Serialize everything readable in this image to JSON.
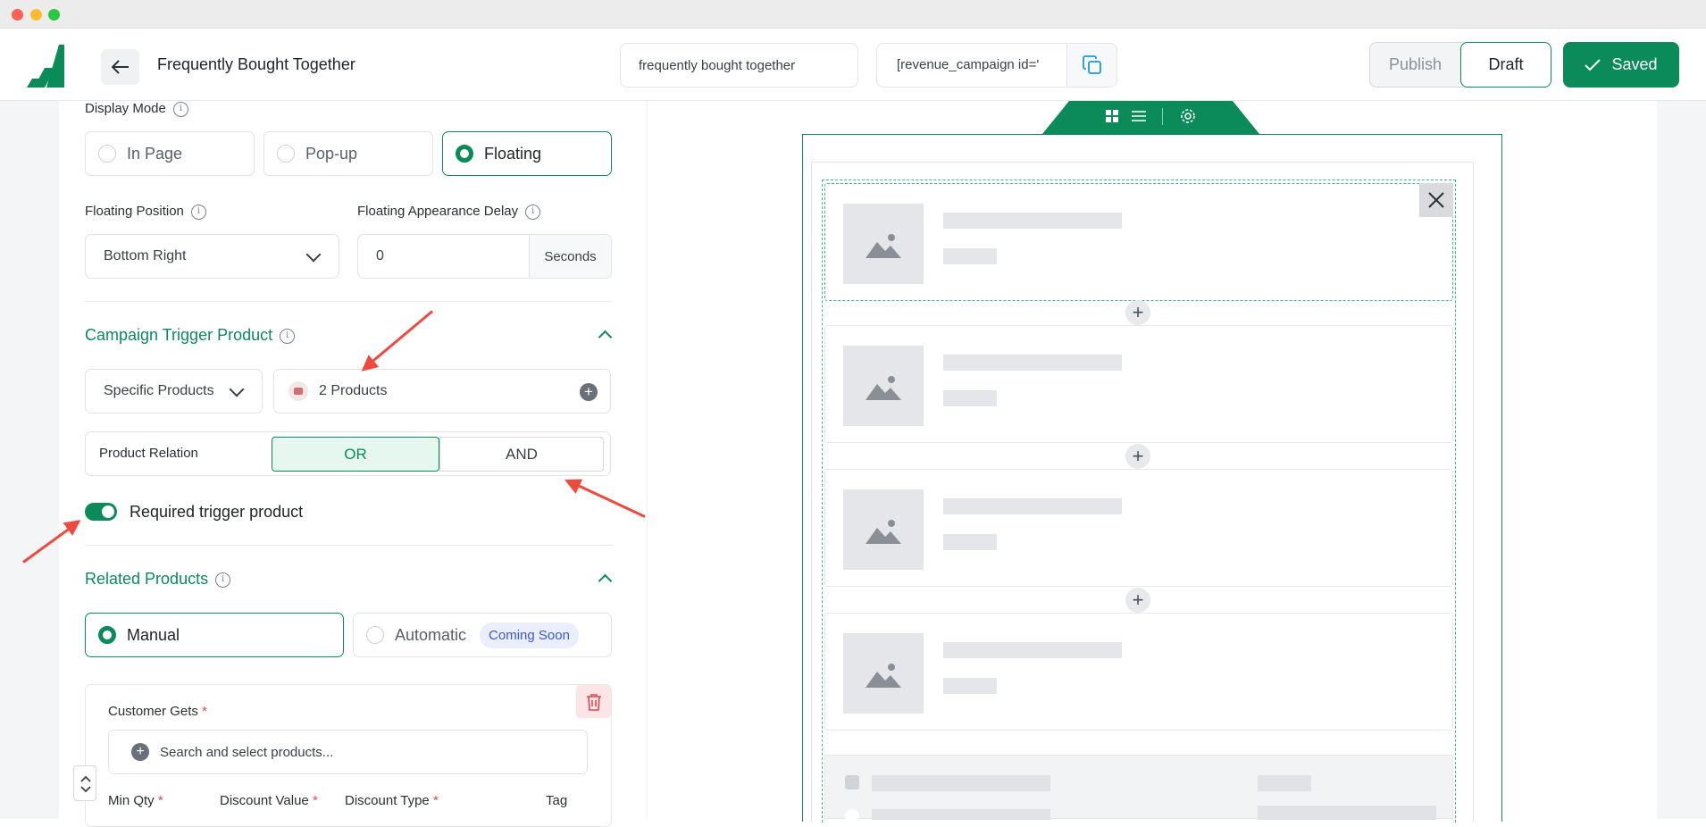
{
  "window": {
    "title": "Frequently Bought Together"
  },
  "header": {
    "title": "Frequently Bought Together",
    "campaign_name_value": "frequently bought together",
    "shortcode_value": "[revenue_campaign id='",
    "publish_label": "Publish",
    "draft_label": "Draft",
    "saved_label": "Saved"
  },
  "display_mode": {
    "label": "Display Mode",
    "options": [
      "In Page",
      "Pop-up",
      "Floating"
    ],
    "selected": "Floating"
  },
  "floating": {
    "position_label": "Floating Position",
    "position_value": "Bottom Right",
    "delay_label": "Floating Appearance Delay",
    "delay_value": "0",
    "delay_unit": "Seconds"
  },
  "trigger": {
    "section_title": "Campaign Trigger Product",
    "type_value": "Specific Products",
    "products_value": "2 Products",
    "relation_label": "Product Relation",
    "relation_options": [
      "OR",
      "AND"
    ],
    "relation_selected": "OR",
    "required_label": "Required trigger product",
    "required_on": true
  },
  "related": {
    "section_title": "Related Products",
    "manual_label": "Manual",
    "automatic_label": "Automatic",
    "coming_soon_badge": "Coming Soon",
    "customer_gets_label": "Customer Gets",
    "required_mark": "*",
    "search_placeholder": "Search and select products...",
    "columns": [
      "Min Qty",
      "Discount Value",
      "Discount Type",
      "Tag"
    ]
  },
  "colors": {
    "accent": "#0b8a5a",
    "annotation_arrow": "#ef4a3f"
  }
}
